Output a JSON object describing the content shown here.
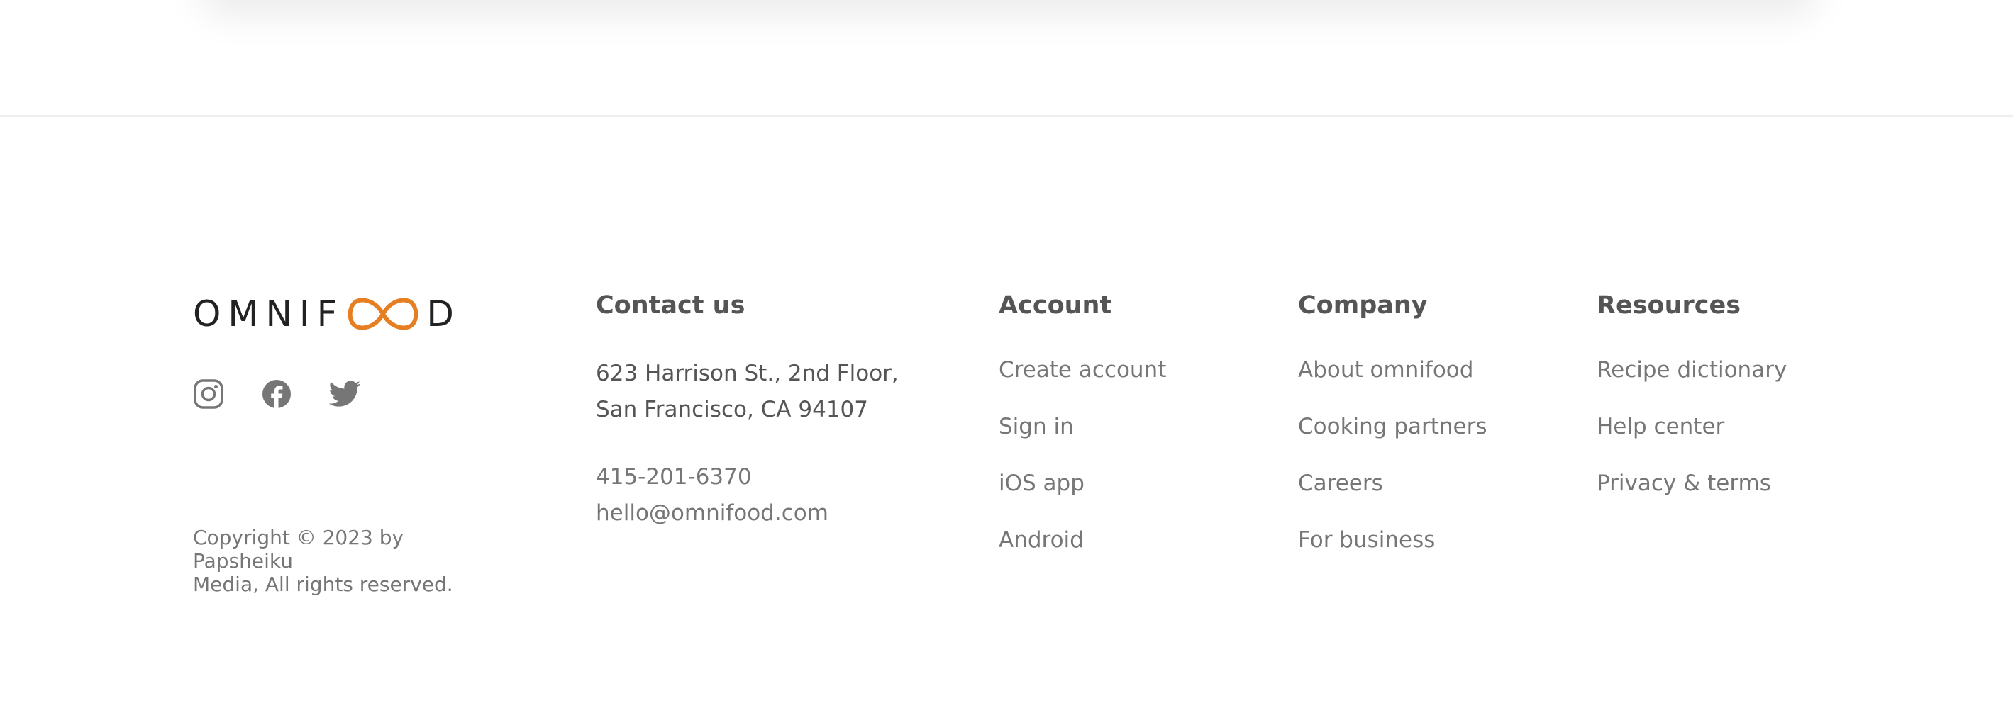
{
  "brand": {
    "logo_prefix": "OMNIF",
    "logo_suffix": "D",
    "logo_accent_color": "#e67e22",
    "social_icons": [
      "instagram-icon",
      "facebook-icon",
      "twitter-icon"
    ],
    "copyright_line1": "Copyright © 2023 by Papsheiku",
    "copyright_line2": "Media, All rights reserved."
  },
  "contact": {
    "heading": "Contact us",
    "address_line1": "623 Harrison St., 2nd Floor,",
    "address_line2": "San Francisco, CA 94107",
    "phone": "415-201-6370",
    "email": "hello@omnifood.com"
  },
  "account": {
    "heading": "Account",
    "links": [
      "Create account",
      "Sign in",
      "iOS app",
      "Android"
    ]
  },
  "company": {
    "heading": "Company",
    "links": [
      "About omnifood",
      "Cooking partners",
      "Careers",
      "For business"
    ]
  },
  "resources": {
    "heading": "Resources",
    "links": [
      "Recipe dictionary",
      "Help center",
      "Privacy & terms"
    ]
  },
  "colors": {
    "heading": "#555555",
    "link": "#767676",
    "accent": "#e67e22",
    "divider": "#eeeeee"
  }
}
